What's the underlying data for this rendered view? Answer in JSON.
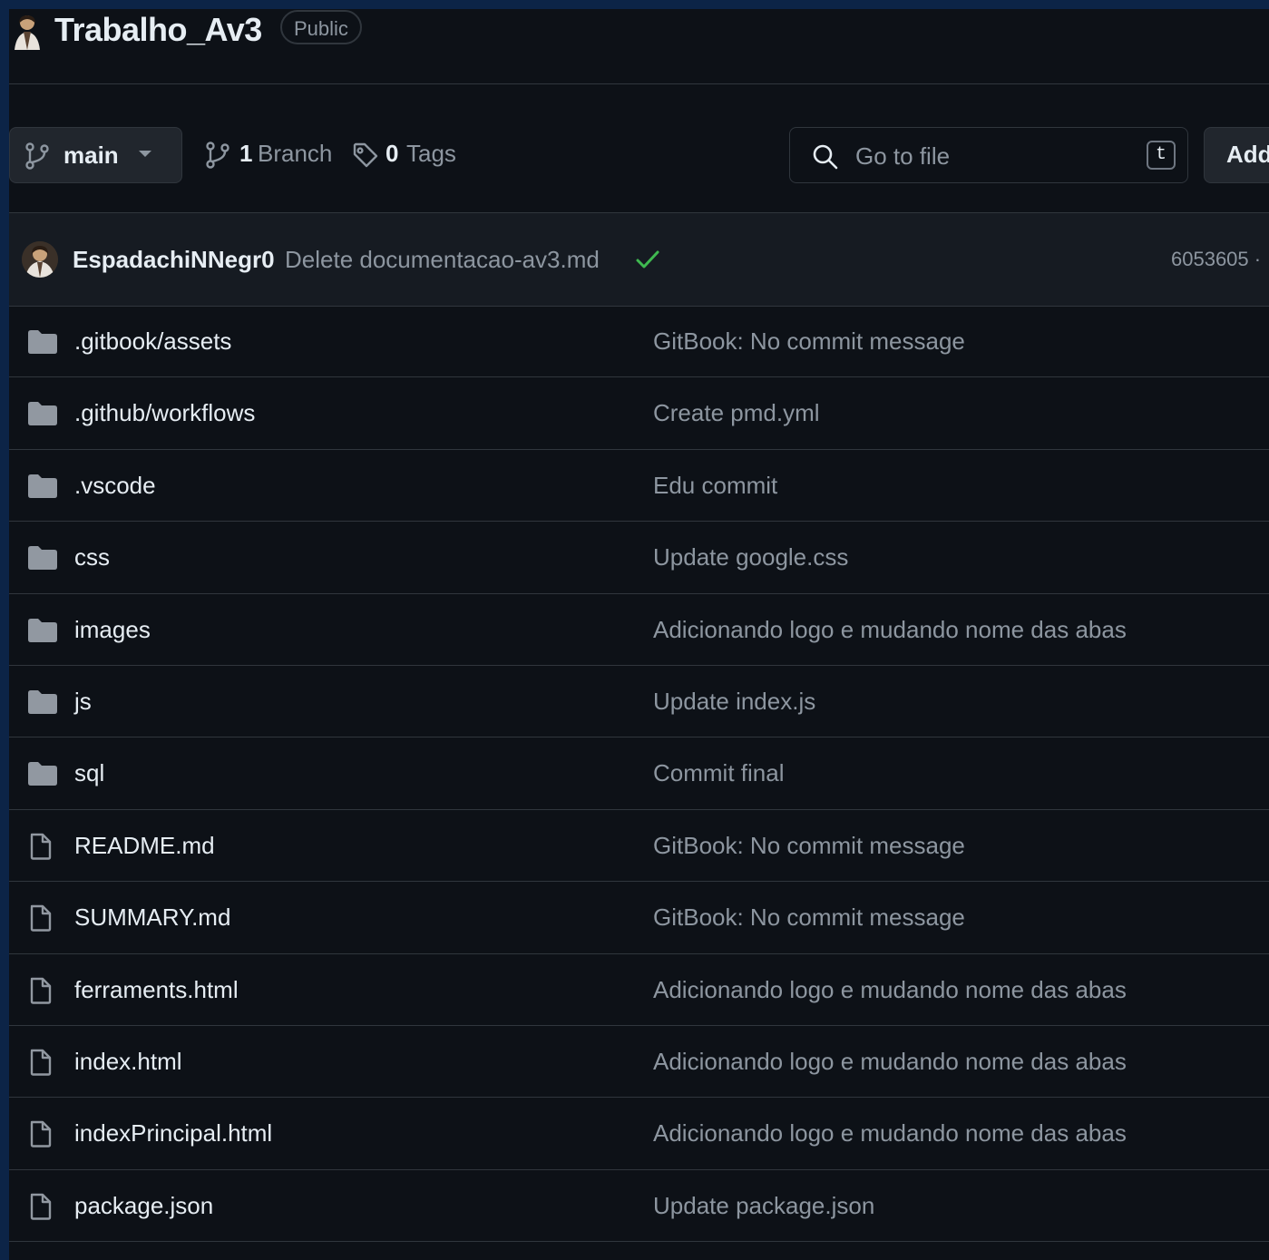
{
  "repo": {
    "name": "Trabalho_Av3",
    "visibility": "Public"
  },
  "toolbar": {
    "branch": "main",
    "branch_count": "1",
    "branch_label": "Branch",
    "tag_count": "0",
    "tag_label": "Tags",
    "search_placeholder": "Go to file",
    "search_shortcut": "t",
    "add_file_label": "Add file"
  },
  "latest_commit": {
    "author": "EspadachiNNegr0",
    "message": "Delete documentacao-av3.md",
    "status": "success",
    "hash": "6053605 · "
  },
  "files": [
    {
      "type": "folder",
      "name": ".gitbook/assets",
      "commit": "GitBook: No commit message"
    },
    {
      "type": "folder",
      "name": ".github/workflows",
      "commit": "Create pmd.yml"
    },
    {
      "type": "folder",
      "name": ".vscode",
      "commit": "Edu commit"
    },
    {
      "type": "folder",
      "name": "css",
      "commit": "Update google.css"
    },
    {
      "type": "folder",
      "name": "images",
      "commit": "Adicionando logo e mudando nome das abas"
    },
    {
      "type": "folder",
      "name": "js",
      "commit": "Update index.js"
    },
    {
      "type": "folder",
      "name": "sql",
      "commit": "Commit final"
    },
    {
      "type": "file",
      "name": "README.md",
      "commit": "GitBook: No commit message"
    },
    {
      "type": "file",
      "name": "SUMMARY.md",
      "commit": "GitBook: No commit message"
    },
    {
      "type": "file",
      "name": "ferraments.html",
      "commit": "Adicionando logo e mudando nome das abas"
    },
    {
      "type": "file",
      "name": "index.html",
      "commit": "Adicionando logo e mudando nome das abas"
    },
    {
      "type": "file",
      "name": "indexPrincipal.html",
      "commit": "Adicionando logo e mudando nome das abas"
    },
    {
      "type": "file",
      "name": "package.json",
      "commit": "Update package.json"
    }
  ],
  "colors": {
    "background": "#0d1117",
    "border": "#30363d",
    "muted_text": "#8d96a0",
    "success": "#3fb950",
    "folder_icon": "#9198a1"
  }
}
